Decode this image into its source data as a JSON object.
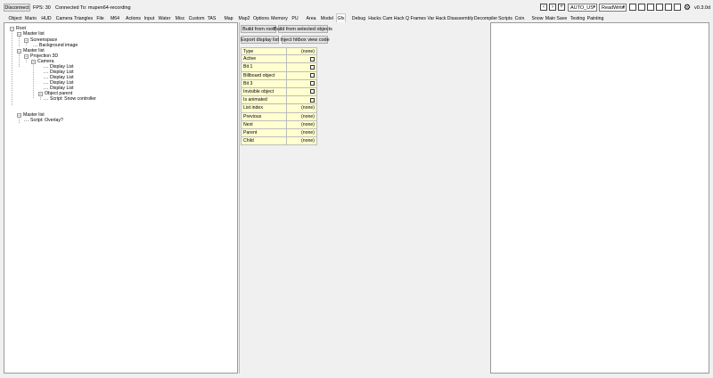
{
  "topbar": {
    "disconnect_label": "Disconnect",
    "fps": "FPS: 30",
    "connected": "Connected To: mupen64-recording",
    "emulator": "AUTO_US",
    "mode": "ReadWrite",
    "version": "v0.3.0d"
  },
  "tabs": [
    "Object",
    "Mario",
    "HUD",
    "Camera",
    "Triangles",
    "File",
    "M64",
    "Actions",
    "Input",
    "Water",
    "Misc",
    "Custom",
    "TAS",
    "Map",
    "Map2",
    "Options",
    "Memory",
    "PU",
    "Area",
    "Model",
    "Gfx",
    "Debug",
    "Hacks",
    "Cam Hack",
    "Q Frames",
    "Var Hack",
    "Disassembly",
    "Decompiler",
    "Scripts",
    "Coin",
    "Snow",
    "Main Save",
    "Testing",
    "Painting"
  ],
  "active_tab": "Gfx",
  "tree": [
    "Root",
    "Master list",
    "Screenspace",
    "Background image",
    "Master list",
    "Projection 3D",
    "Camera",
    "Display List",
    "Display List",
    "Display List",
    "Display List",
    "Display List",
    "Object parent",
    "Script: Snow controller",
    "Master list",
    "Script: Overlay?"
  ],
  "buttons": {
    "build_root": "Build from root",
    "build_selected": "Build from selected objects",
    "export": "Export display list",
    "inject": "Inject hitbox view code"
  },
  "props": [
    {
      "key": "Type",
      "value": "(none)"
    },
    {
      "key": "Active",
      "value": ""
    },
    {
      "key": "Bit 1",
      "value": ""
    },
    {
      "key": "Billboard object",
      "value": ""
    },
    {
      "key": "Bit 3",
      "value": ""
    },
    {
      "key": "Invisible object",
      "value": ""
    },
    {
      "key": "Is animated",
      "value": ""
    },
    {
      "key": "List index",
      "value": "(none)"
    },
    {
      "key": "Previous",
      "value": "(none)"
    },
    {
      "key": "Next",
      "value": "(none)"
    },
    {
      "key": "Parent",
      "value": "(none)"
    },
    {
      "key": "Child",
      "value": "(none)"
    }
  ]
}
